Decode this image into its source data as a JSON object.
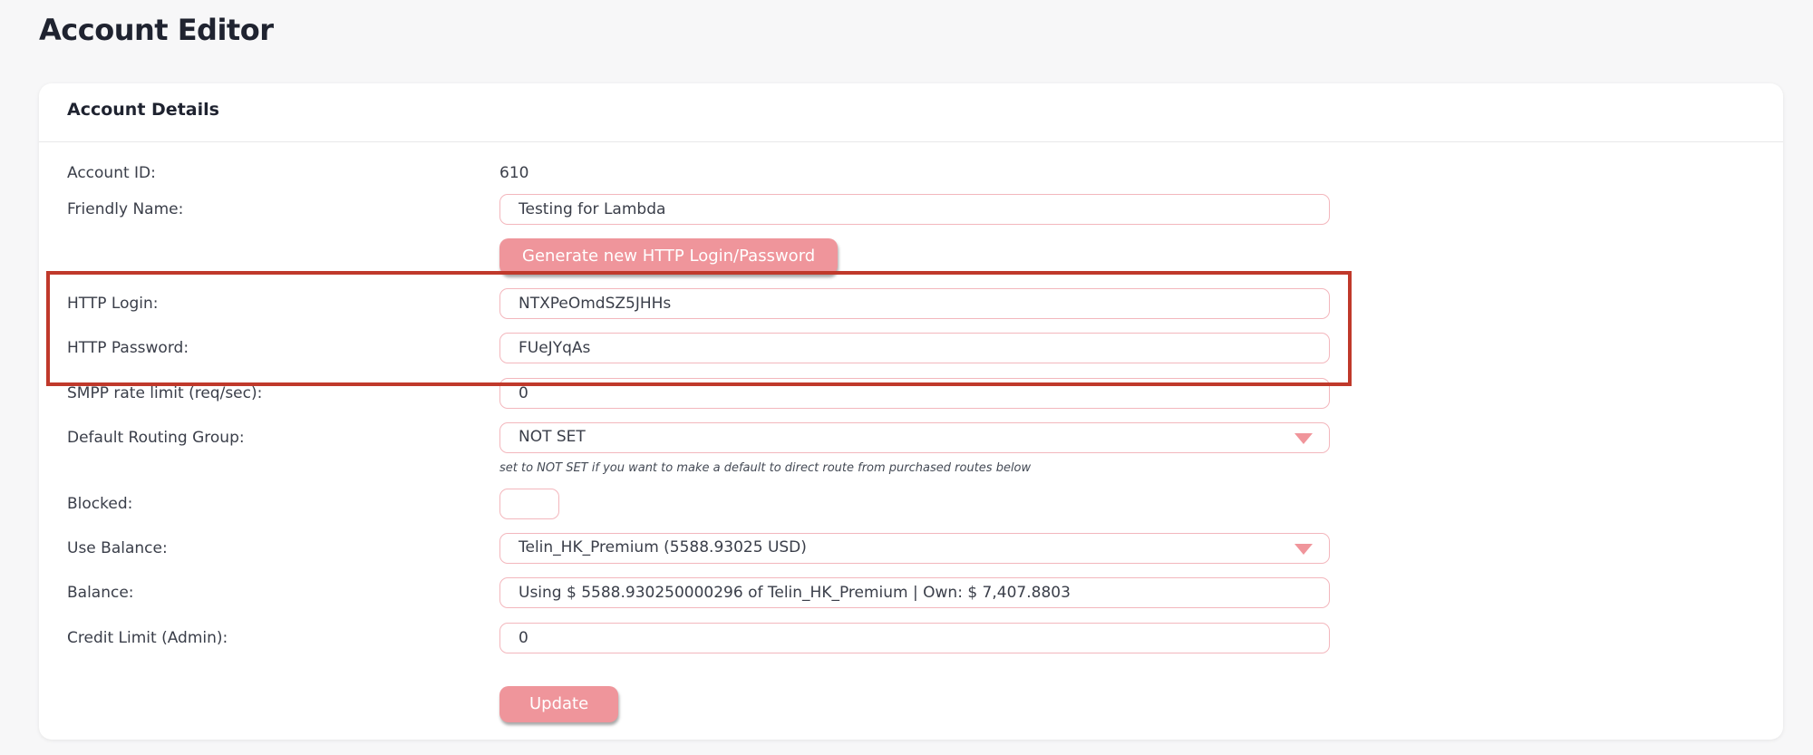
{
  "page": {
    "title": "Account Editor"
  },
  "card": {
    "title": "Account Details"
  },
  "fields": {
    "account_id": {
      "label": "Account ID:",
      "value": "610"
    },
    "friendly_name": {
      "label": "Friendly Name:",
      "value": "Testing for Lambda"
    },
    "generate_button": "Generate new HTTP Login/Password",
    "http_login": {
      "label": "HTTP Login:",
      "value": "NTXPeOmdSZ5JHHs"
    },
    "http_password": {
      "label": "HTTP Password:",
      "value": "FUeJYqAs"
    },
    "smpp_rate": {
      "label": "SMPP rate limit (req/sec):",
      "value": "0"
    },
    "routing_group": {
      "label": "Default Routing Group:",
      "value": "NOT SET",
      "hint": "set to NOT SET if you want to make a default to direct route from purchased routes below"
    },
    "blocked": {
      "label": "Blocked:",
      "checked": false
    },
    "use_balance": {
      "label": "Use Balance:",
      "value": "Telin_HK_Premium (5588.93025 USD)"
    },
    "balance": {
      "label": "Balance:",
      "value": "Using $ 5588.930250000296 of Telin_HK_Premium | Own: $ 7,407.8803"
    },
    "credit_limit": {
      "label": "Credit Limit (Admin):",
      "value": "0"
    }
  },
  "actions": {
    "update_label": "Update"
  },
  "colors": {
    "accent": "#ef959b",
    "field_border": "#f3b7bd",
    "highlight": "#c0392b"
  },
  "icons": {
    "dropdown": "chevron-down-icon"
  }
}
